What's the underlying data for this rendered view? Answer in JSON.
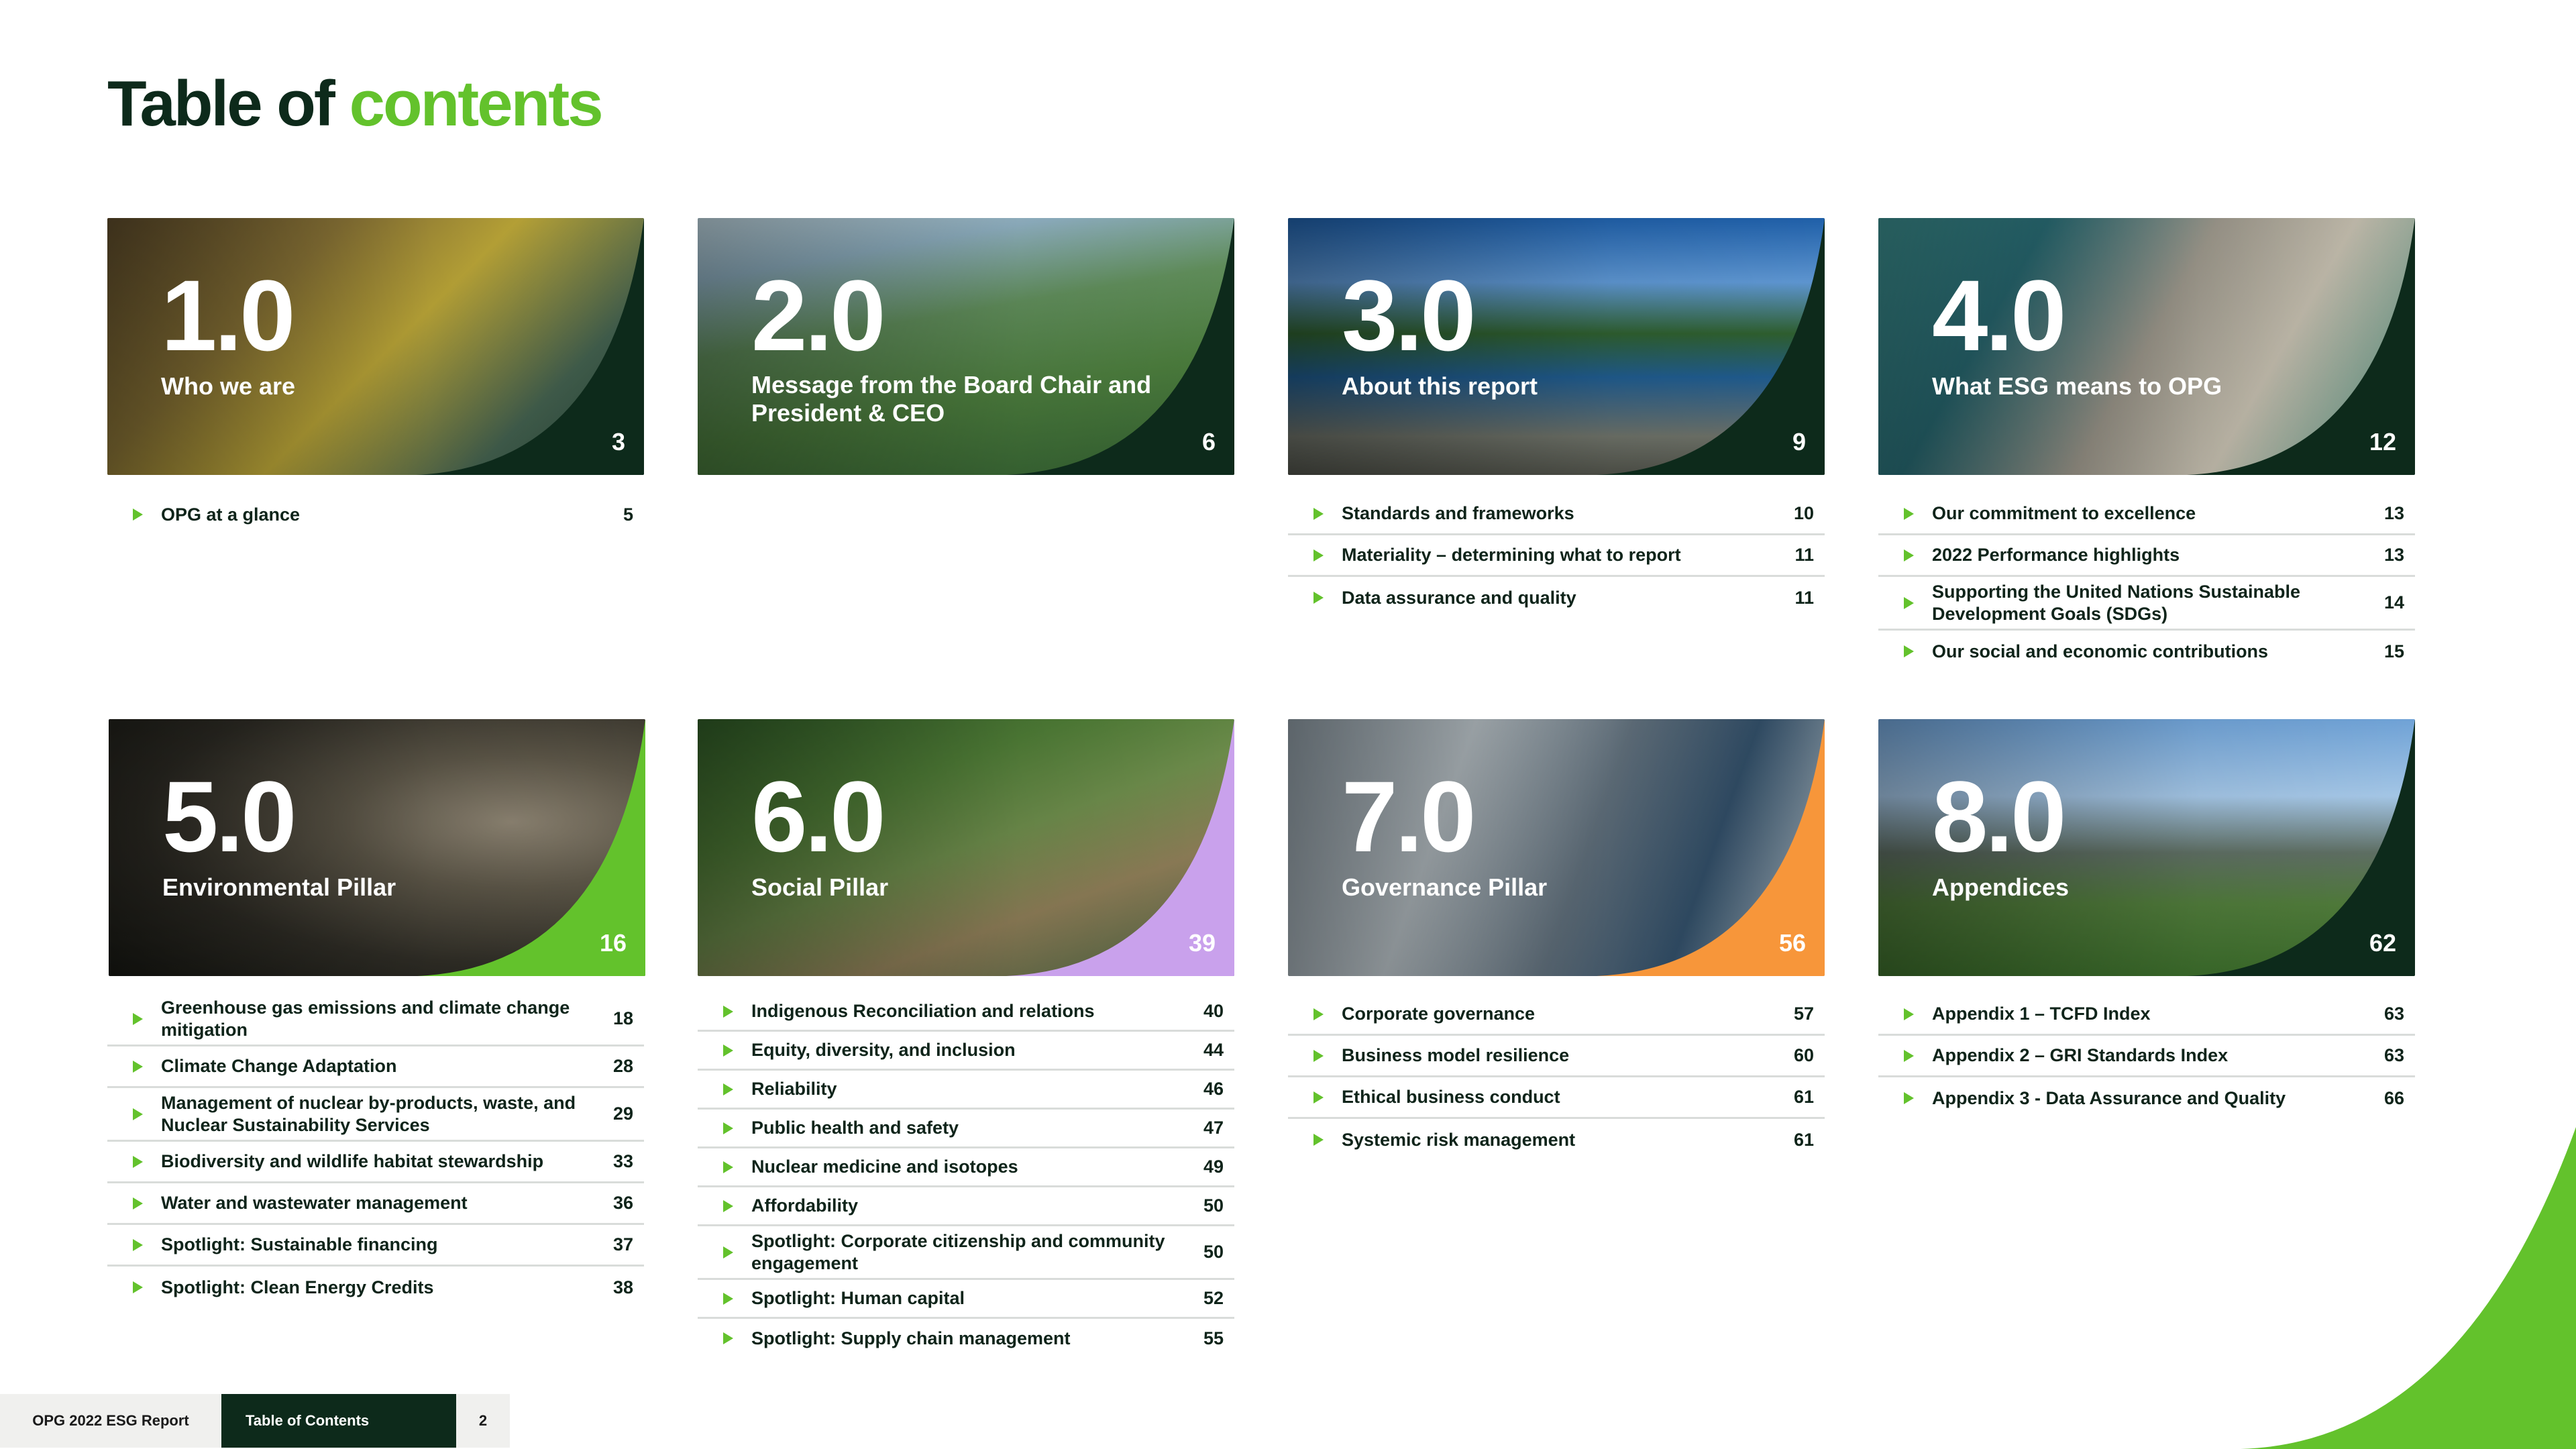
{
  "title": {
    "part1": "Table of",
    "part2": "contents"
  },
  "colors": {
    "dark": "#0d2a1b",
    "green": "#63c22c",
    "purple": "#c9a1ec",
    "orange": "#f7963a"
  },
  "sections": [
    {
      "number": "1.0",
      "title": "Who we are",
      "page": "3",
      "items": [
        {
          "label": "OPG at a glance",
          "page": "5"
        }
      ]
    },
    {
      "number": "2.0",
      "title": "Message from the Board Chair and President & CEO",
      "page": "6",
      "items": []
    },
    {
      "number": "3.0",
      "title": "About this report",
      "page": "9",
      "items": [
        {
          "label": "Standards and frameworks",
          "page": "10"
        },
        {
          "label": "Materiality – determining what to report",
          "page": "11"
        },
        {
          "label": "Data assurance and quality",
          "page": "11"
        }
      ]
    },
    {
      "number": "4.0",
      "title": "What ESG means to OPG",
      "page": "12",
      "items": [
        {
          "label": "Our commitment to excellence",
          "page": "13"
        },
        {
          "label": "2022 Performance highlights",
          "page": "13"
        },
        {
          "label": "Supporting the United Nations Sustainable Development Goals (SDGs)",
          "page": "14"
        },
        {
          "label": "Our social and economic contributions",
          "page": "15"
        }
      ]
    },
    {
      "number": "5.0",
      "title": "Environmental Pillar",
      "page": "16",
      "items": [
        {
          "label": "Greenhouse gas emissions and climate change mitigation",
          "page": "18"
        },
        {
          "label": "Climate Change Adaptation",
          "page": "28"
        },
        {
          "label": "Management of nuclear by-products, waste, and Nuclear Sustainability Services",
          "page": "29"
        },
        {
          "label": "Biodiversity and wildlife habitat stewardship",
          "page": "33"
        },
        {
          "label": "Water and wastewater management",
          "page": "36"
        },
        {
          "label": "Spotlight: Sustainable financing",
          "page": "37"
        },
        {
          "label": "Spotlight: Clean Energy Credits",
          "page": "38"
        }
      ]
    },
    {
      "number": "6.0",
      "title": "Social Pillar",
      "page": "39",
      "items": [
        {
          "label": "Indigenous Reconciliation and relations",
          "page": "40"
        },
        {
          "label": "Equity, diversity, and inclusion",
          "page": "44"
        },
        {
          "label": "Reliability",
          "page": "46"
        },
        {
          "label": "Public health and safety",
          "page": "47"
        },
        {
          "label": "Nuclear medicine and isotopes",
          "page": "49"
        },
        {
          "label": "Affordability",
          "page": "50"
        },
        {
          "label": "Spotlight: Corporate citizenship and community engagement",
          "page": "50"
        },
        {
          "label": "Spotlight: Human capital",
          "page": "52"
        },
        {
          "label": "Spotlight: Supply chain management",
          "page": "55"
        }
      ]
    },
    {
      "number": "7.0",
      "title": "Governance Pillar",
      "page": "56",
      "items": [
        {
          "label": "Corporate governance",
          "page": "57"
        },
        {
          "label": "Business model resilience",
          "page": "60"
        },
        {
          "label": "Ethical business conduct",
          "page": "61"
        },
        {
          "label": "Systemic risk management",
          "page": "61"
        }
      ]
    },
    {
      "number": "8.0",
      "title": "Appendices",
      "page": "62",
      "items": [
        {
          "label": "Appendix 1 – TCFD Index",
          "page": "63"
        },
        {
          "label": "Appendix 2 – GRI Standards Index",
          "page": "63"
        },
        {
          "label": "Appendix 3 - Data Assurance and Quality",
          "page": "66"
        }
      ]
    }
  ],
  "footer": {
    "report": "OPG 2022 ESG Report",
    "section": "Table of Contents",
    "page": "2"
  }
}
